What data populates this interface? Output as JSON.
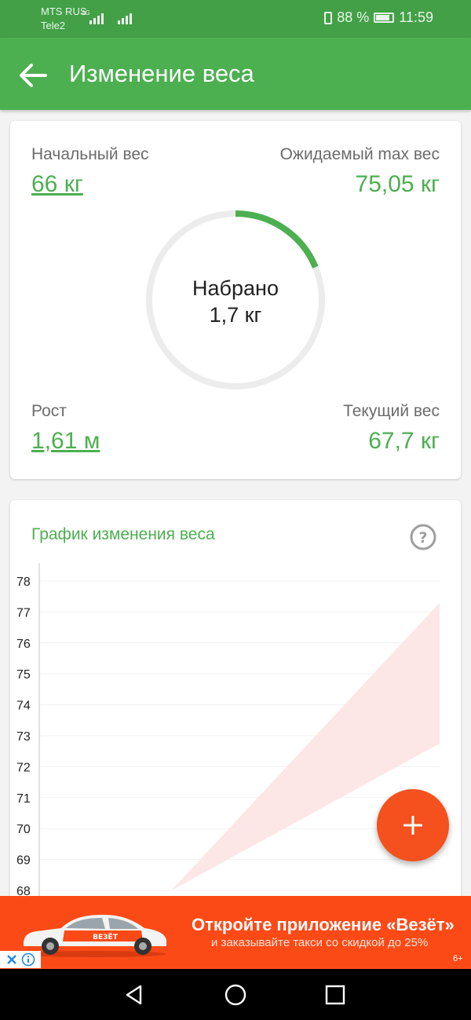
{
  "status_bar": {
    "carrier1": "MTS RUS",
    "carrier1_tech": "4G",
    "carrier2": "Tele2",
    "battery": "88 %",
    "time": "11:59"
  },
  "app_bar": {
    "title": "Изменение веса",
    "back_icon": "arrow-left-icon"
  },
  "summary": {
    "start_weight_label": "Начальный вес",
    "start_weight_value": "66 кг",
    "expected_max_label": "Ожидаемый max вес",
    "expected_max_value": "75,05 кг",
    "gained_label": "Набрано",
    "gained_value": "1,7 кг",
    "gained_fraction": 0.188,
    "height_label": "Рост",
    "height_value": "1,61 м",
    "current_weight_label": "Текущий вес",
    "current_weight_value": "67,7 кг"
  },
  "chart_card": {
    "title": "График изменения веса",
    "help_icon": "question-circle-icon"
  },
  "chart_data": {
    "type": "area",
    "title": "График изменения веса",
    "ylim": [
      68,
      78
    ],
    "y_ticks": [
      78,
      77,
      76,
      75,
      74,
      73,
      72,
      71,
      70,
      69,
      68
    ],
    "y_tick_labels": [
      "78",
      "77",
      "76",
      "75",
      "74",
      "73",
      "72",
      "71",
      "70",
      "69",
      "68"
    ],
    "xlim": [
      0,
      1
    ],
    "series": [
      {
        "x": [
          0.33,
          1.0
        ],
        "lower": [
          68.0,
          72.75
        ],
        "upper": [
          68.0,
          77.3
        ]
      }
    ],
    "grid": true,
    "band_color": "#fde6e6"
  },
  "fab": {
    "icon": "plus-icon"
  },
  "ad": {
    "headline": "Откройте приложение «Везёт»",
    "sub": "и заказывайте такси со скидкой до 25%",
    "age": "6+",
    "car_label": "ВЕЗЁТ",
    "close_icon": "close-icon",
    "info_icon": "info-icon"
  },
  "nav_bar": {
    "back_icon": "triangle-back-icon",
    "home_icon": "circle-home-icon",
    "recents_icon": "square-recents-icon"
  },
  "colors": {
    "primary": "#4caf50",
    "status_bar": "#43a047",
    "fab": "#f4511e",
    "ad_background": "#fc4a17",
    "ring_track": "#ececec"
  }
}
